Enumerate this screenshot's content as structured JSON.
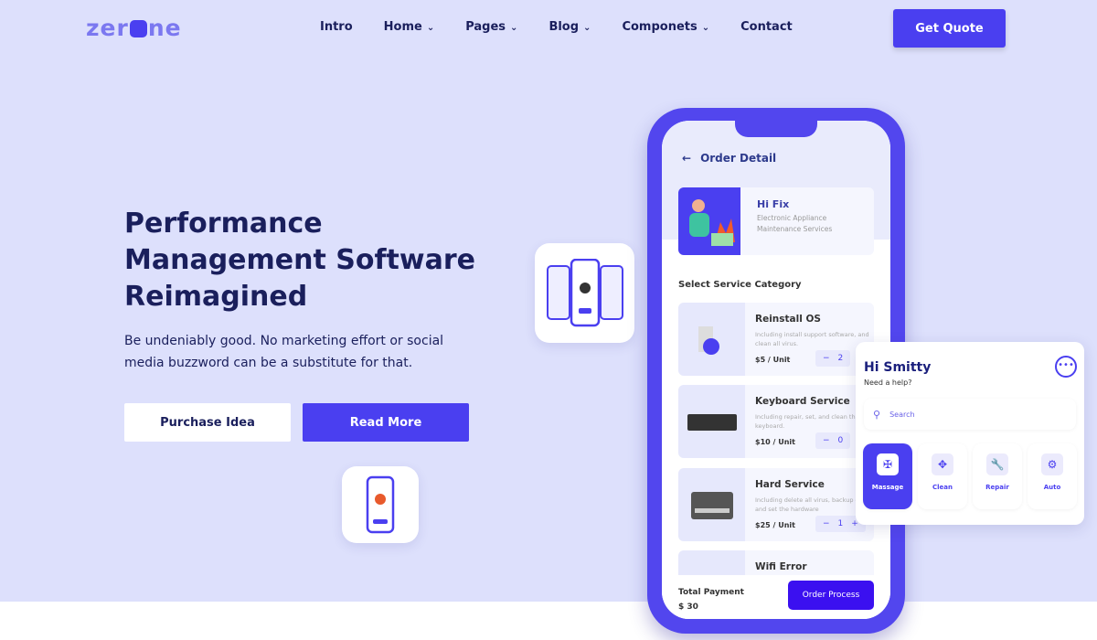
{
  "brand": {
    "logo_pre": "zer",
    "logo_post": "ne"
  },
  "nav": {
    "items": [
      {
        "label": "Intro",
        "chev": false
      },
      {
        "label": "Home",
        "chev": true
      },
      {
        "label": "Pages",
        "chev": true
      },
      {
        "label": "Blog",
        "chev": true
      },
      {
        "label": "Componets",
        "chev": true
      },
      {
        "label": "Contact",
        "chev": false
      }
    ],
    "cta": "Get Quote"
  },
  "hero": {
    "title_lines": [
      "Performance",
      "Management Software",
      "Reimagined"
    ],
    "subtitle": "Be undeniably good. No marketing effort or social media buzzword can be a substitute for that.",
    "btn_primary": "Read More",
    "btn_secondary": "Purchase Idea"
  },
  "phone": {
    "header": "Order Detail",
    "provider": {
      "name": "Hi Fix",
      "desc": "Electronic Appliance Maintenance Services"
    },
    "section": "Select Service Category",
    "services": [
      {
        "title": "Reinstall OS",
        "desc": "Including install support software, and clean all virus.",
        "price": "$5 / Unit",
        "qty": "2"
      },
      {
        "title": "Keyboard Service",
        "desc": "Including repair, set, and clean the keyboard.",
        "price": "$10 / Unit",
        "qty": "0"
      },
      {
        "title": "Hard Service",
        "desc": "Including delete all virus, backup data and set the hardware",
        "price": "$25 / Unit",
        "qty": "1"
      },
      {
        "title": "Wifi Error",
        "desc": "",
        "price": "",
        "qty": ""
      }
    ],
    "total_label": "Total Payment",
    "total_value": "$ 30",
    "order_btn": "Order Process"
  },
  "help": {
    "greeting": "Hi Smitty",
    "prompt": "Need a help?",
    "search_placeholder": "Search",
    "categories": [
      {
        "label": "Massage",
        "icon": "foot-icon",
        "selected": true
      },
      {
        "label": "Clean",
        "icon": "clean-icon",
        "selected": false
      },
      {
        "label": "Repair",
        "icon": "wrench-icon",
        "selected": false
      },
      {
        "label": "Auto",
        "icon": "gear-icon",
        "selected": false
      }
    ]
  },
  "colors": {
    "accent": "#4a3ff0",
    "background": "#dde0fc",
    "text": "#1a1f5c"
  }
}
